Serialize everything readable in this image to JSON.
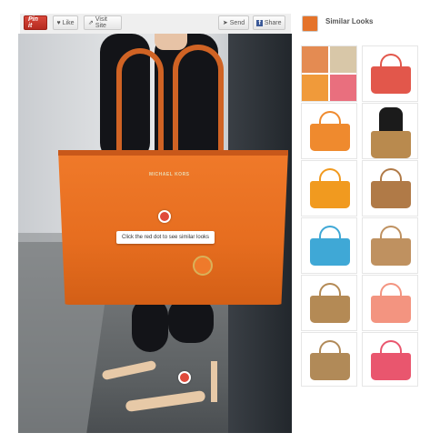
{
  "toolbar": {
    "pin_label": "Pin it",
    "like_label": "Like",
    "visit_label": "Visit Site",
    "send_label": "Send",
    "share_label": "Share"
  },
  "photo": {
    "bag_brand": "MICHAEL KORS",
    "hint_text": "Click the red dot to see similar looks"
  },
  "sidebar": {
    "title": "Similar Looks",
    "tiles": [
      {
        "color": "#e48b52",
        "kind": "collage"
      },
      {
        "color": "#e2574b",
        "kind": "tote"
      },
      {
        "color": "#ef8a2e",
        "kind": "tote"
      },
      {
        "color": "#b98a4e",
        "kind": "person"
      },
      {
        "color": "#f19a1f",
        "kind": "tote"
      },
      {
        "color": "#b07a47",
        "kind": "tote"
      },
      {
        "color": "#3fa8d6",
        "kind": "tote"
      },
      {
        "color": "#bf9160",
        "kind": "tote"
      },
      {
        "color": "#b48a55",
        "kind": "tote"
      },
      {
        "color": "#f39480",
        "kind": "tote"
      },
      {
        "color": "#b18a58",
        "kind": "tote"
      },
      {
        "color": "#e9566e",
        "kind": "tote"
      }
    ]
  }
}
